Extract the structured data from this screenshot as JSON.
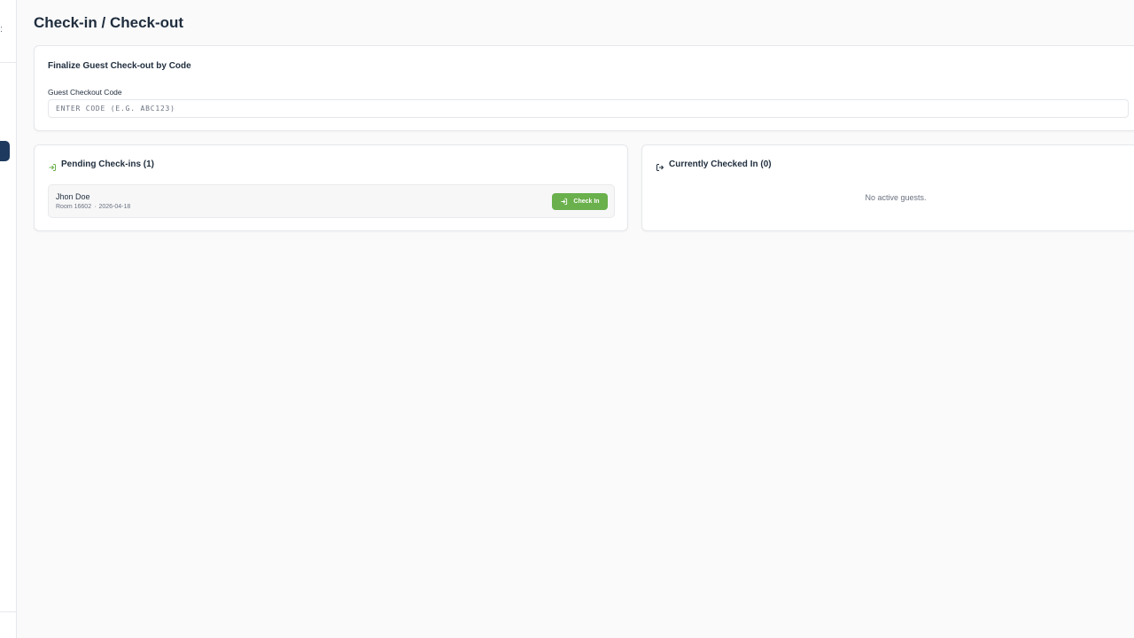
{
  "page": {
    "title": "Check-in / Check-out"
  },
  "checkout_by_code": {
    "title": "Finalize Guest Check-out by Code",
    "field_label": "Guest Checkout Code",
    "placeholder": "ENTER CODE (E.G. ABC123)",
    "value": ""
  },
  "pending_checkins": {
    "title": "Pending Check-ins (1)",
    "icon": "log-in-icon",
    "guests": [
      {
        "name": "Jhon Doe",
        "room": "Room 16602",
        "separator": "·",
        "date": "2026-04-18",
        "action_label": "Check In"
      }
    ]
  },
  "checked_in": {
    "title": "Currently Checked In (0)",
    "icon": "log-out-icon",
    "empty_text": "No active guests."
  },
  "colors": {
    "accent_green": "#6ab04c",
    "sidebar_active": "#1e3a5f",
    "text_dark": "#1f2d3d",
    "text_muted": "#6b7280"
  }
}
